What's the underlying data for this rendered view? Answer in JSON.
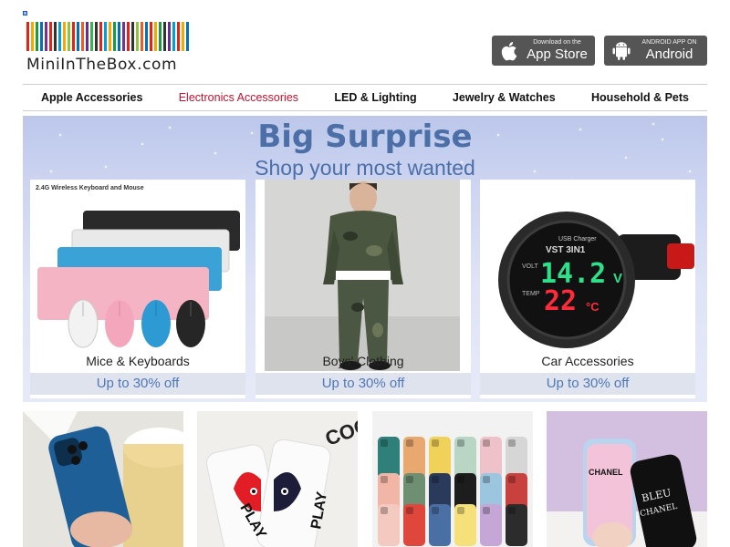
{
  "logo": {
    "text": "MiniInTheBox.com",
    "bar_colors": [
      "#e2231a",
      "#f7a800",
      "#1a9c3e",
      "#0072bc",
      "#7b2f8e",
      "#e2231a",
      "#333333",
      "#00a0dc",
      "#f7a800",
      "#8dc63f",
      "#e2231a",
      "#0072bc",
      "#f15a24",
      "#662d91",
      "#39b54a",
      "#333333",
      "#e2231a",
      "#00a0dc",
      "#f7a800",
      "#1a9c3e",
      "#0072bc",
      "#7b2f8e",
      "#e2231a",
      "#333333",
      "#8dc63f",
      "#f15a24",
      "#0072bc",
      "#e2231a",
      "#f7a800",
      "#1a9c3e",
      "#333333",
      "#662d91",
      "#00a0dc",
      "#e2231a",
      "#f7a800",
      "#0072bc"
    ]
  },
  "badges": {
    "appstore": {
      "small": "Download on the",
      "big": "App Store",
      "icon": "apple-icon"
    },
    "android": {
      "small": "ANDROID APP ON",
      "big": "Android",
      "icon": "android-icon"
    }
  },
  "nav": {
    "items": [
      {
        "label": "Apple Accessories",
        "active": false
      },
      {
        "label": "Electronics Accessories",
        "active": true
      },
      {
        "label": "LED & Lighting",
        "active": false
      },
      {
        "label": "Jewelry & Watches",
        "active": false
      },
      {
        "label": "Household & Pets",
        "active": false
      }
    ]
  },
  "banner": {
    "title": "Big Surprise",
    "subtitle": "Shop your most wanted",
    "cards": [
      {
        "name": "Mice & Keyboards",
        "deal": "Up to 30% off",
        "image_caption": "2.4G Wireless Keyboard and Mouse"
      },
      {
        "name": "Boys' Clothing",
        "deal": "Up to 30% off"
      },
      {
        "name": "Car Accessories",
        "deal": "Up to 30% off",
        "device": {
          "label1": "USB Charger",
          "label2": "VST 3IN1",
          "volt_label": "VOLT",
          "volt_value": "14.2",
          "volt_unit": "V",
          "temp_label": "TEMP",
          "temp_value": "22",
          "temp_unit": "°C"
        }
      }
    ]
  },
  "thumbs": {
    "t2": {
      "text1": "PLAY",
      "text2": "PLAY",
      "bg_text": "COO"
    },
    "t4": {
      "text1": "CHANEL",
      "text2": "BLEU",
      "text3": "CHANEL"
    }
  },
  "colors": {
    "accent_red": "#c8102e",
    "banner_blue": "#4b6fa6",
    "deal_blue": "#4f78b8"
  }
}
